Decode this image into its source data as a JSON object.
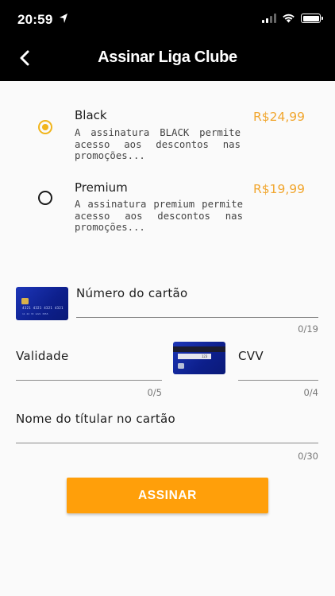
{
  "status_bar": {
    "time": "20:59"
  },
  "header": {
    "title": "Assinar Liga Clube"
  },
  "plans": [
    {
      "name": "Black",
      "price": "R$24,99",
      "description": "A assinatura BLACK permite acesso aos descontos nas promoções...",
      "selected": true
    },
    {
      "name": "Premium",
      "price": "R$19,99",
      "description": "A assinatura premium permite acesso aos descontos nas promoções...",
      "selected": false
    }
  ],
  "card_graphic": {
    "number": "4321 4321 4321 4321",
    "sub": "11 22 33      1221 3955",
    "cvv": "123"
  },
  "form": {
    "card_number": {
      "label": "Número do cartão",
      "counter": "0/19"
    },
    "expiry": {
      "label": "Validade",
      "counter": "0/5"
    },
    "cvv": {
      "label": "CVV",
      "counter": "0/4"
    },
    "holder_name": {
      "label": "Nome do títular no cartão",
      "counter": "0/30"
    }
  },
  "actions": {
    "subscribe_label": "ASSINAR"
  },
  "colors": {
    "accent": "#ff9f0a",
    "price": "#f1a62e",
    "radio_selected": "#f1b51c",
    "header_bg": "#000000"
  }
}
